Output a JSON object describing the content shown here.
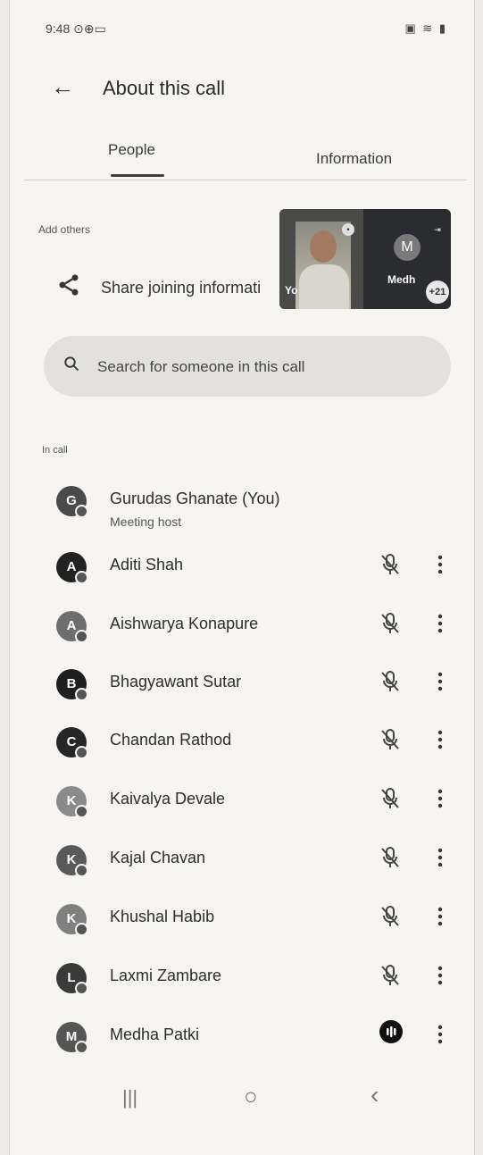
{
  "status_bar": {
    "time": "9:48",
    "left_icons": "⊙⊕▭",
    "right_icons": "▣ ≋ ▮"
  },
  "header": {
    "title": "About this call",
    "back_icon": "arrow-back-icon"
  },
  "tabs": [
    {
      "label": "People",
      "selected": true
    },
    {
      "label": "Information",
      "selected": false
    }
  ],
  "add_others": {
    "label": "Add others",
    "share_label": "Share joining informati"
  },
  "pip": {
    "self_label": "Yo",
    "other_initial": "M",
    "other_label": "Medh",
    "more_count": "+21"
  },
  "search": {
    "placeholder": "Search for someone in this call"
  },
  "in_call": {
    "label": "In call"
  },
  "participants": [
    {
      "initial": "G",
      "name": "Gurudas Ghanate (You)",
      "role": "Meeting host",
      "color": "#4a4a4a"
    },
    {
      "initial": "A",
      "name": "Aditi Shah",
      "color": "#222222"
    },
    {
      "initial": "A",
      "name": "Aishwarya Konapure",
      "color": "#6e6e6e"
    },
    {
      "initial": "B",
      "name": "Bhagyawant Sutar",
      "color": "#1f1f1f"
    },
    {
      "initial": "C",
      "name": "Chandan Rathod",
      "color": "#262626"
    },
    {
      "initial": "K",
      "name": "Kaivalya Devale",
      "color": "#8a8a8a"
    },
    {
      "initial": "K",
      "name": "Kajal Chavan",
      "color": "#5a5a5a"
    },
    {
      "initial": "K",
      "name": "Khushal Habib",
      "color": "#808080"
    },
    {
      "initial": "L",
      "name": "Laxmi Zambare",
      "color": "#3a3a3a"
    },
    {
      "initial": "M",
      "name": "Medha Patki",
      "color": "#555555",
      "speaking": true
    }
  ],
  "nav": {
    "recents_icon": "|||",
    "home_icon": "○",
    "back_icon": "‹"
  }
}
